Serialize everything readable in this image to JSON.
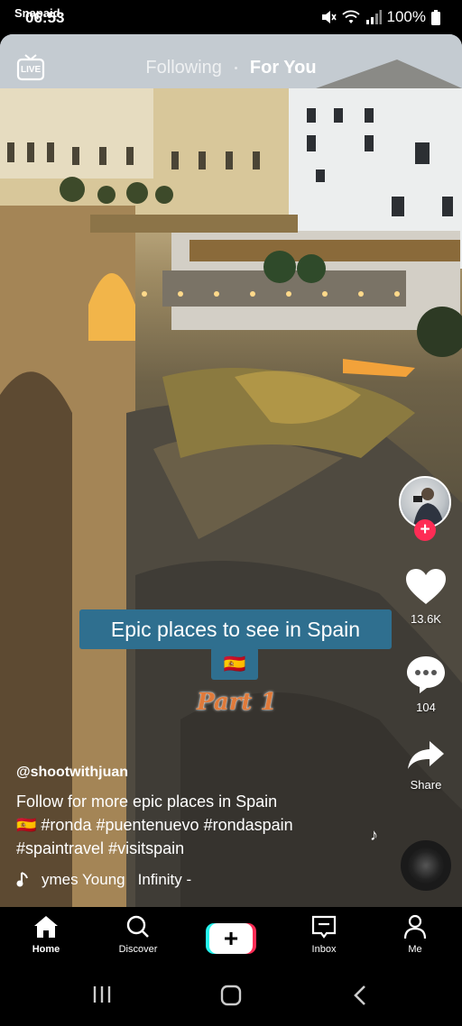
{
  "status": {
    "time": "06:53",
    "overlay_label": "Snapaid",
    "battery": "100%",
    "icons": [
      "mute-icon",
      "wifi-icon",
      "signal-icon",
      "battery-icon"
    ]
  },
  "top_nav": {
    "live_label": "LIVE",
    "following_label": "Following",
    "foryou_label": "For You"
  },
  "video_overlay": {
    "caption": "Epic places to see in Spain",
    "flag": "🇪🇸",
    "part": "Part 1"
  },
  "side_actions": {
    "likes": "13.6K",
    "comments": "104",
    "share_label": "Share",
    "follow_symbol": "+"
  },
  "post": {
    "username": "@shootwithjuan",
    "description_line1": "Follow for more epic places in Spain",
    "description_line2": "🇪🇸 #ronda #puentenuevo #rondaspain",
    "description_line3": "#spaintravel #visitspain",
    "music_text_1": "ymes Young",
    "music_text_2": "Infinity -"
  },
  "bottom_nav": {
    "home": "Home",
    "discover": "Discover",
    "create": "+",
    "inbox": "Inbox",
    "me": "Me"
  },
  "colors": {
    "accent_red": "#fe2c55",
    "accent_cyan": "#25f4ee",
    "caption_bg": "#2f6f8f"
  }
}
